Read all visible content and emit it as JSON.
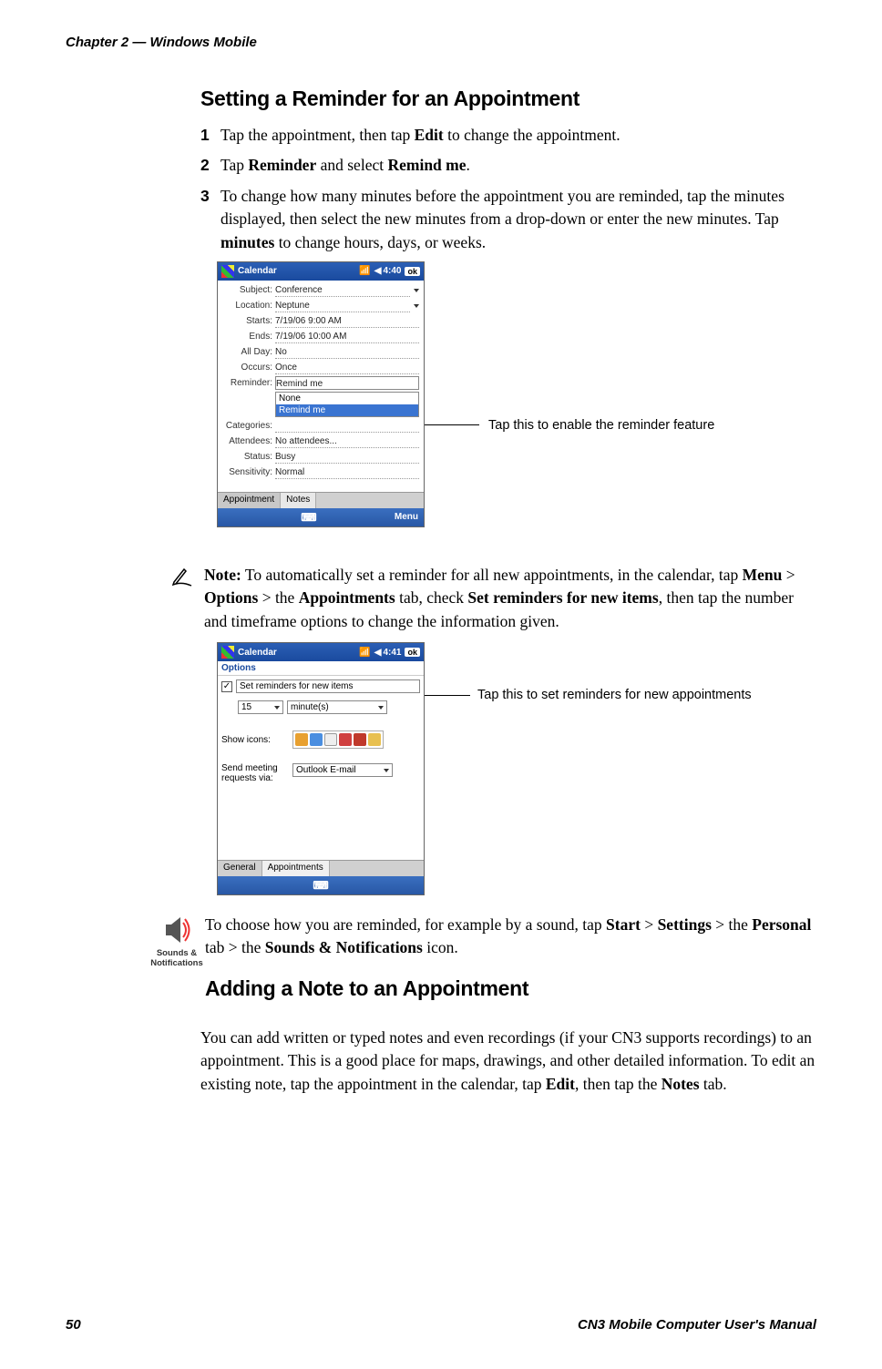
{
  "header": {
    "chapter": "Chapter 2 — Windows Mobile"
  },
  "footer": {
    "page": "50",
    "manual": "CN3 Mobile Computer User's Manual"
  },
  "section1": {
    "title": "Setting a Reminder for an Appointment",
    "steps": {
      "s1": {
        "num": "1",
        "pre": "Tap the appointment, then tap ",
        "bold": "Edit",
        "post": " to change the appointment."
      },
      "s2": {
        "num": "2",
        "pre": "Tap ",
        "bold1": "Reminder",
        "mid": " and select ",
        "bold2": "Remind me",
        "post": "."
      },
      "s3": {
        "num": "3",
        "pre": "To change how many minutes before the appointment you are reminded, tap the minutes displayed, then select the new minutes from a drop-down or enter the new minutes. Tap ",
        "bold": "minutes",
        "post": " to change hours, days, or weeks."
      }
    }
  },
  "shot1": {
    "title": "Calendar",
    "time": "4:40",
    "ok": "ok",
    "rows": {
      "subject": {
        "label": "Subject:",
        "value": "Conference"
      },
      "location": {
        "label": "Location:",
        "value": "Neptune"
      },
      "starts": {
        "label": "Starts:",
        "value": "7/19/06    9:00 AM"
      },
      "ends": {
        "label": "Ends:",
        "value": "7/19/06    10:00 AM"
      },
      "allday": {
        "label": "All Day:",
        "value": "No"
      },
      "occurs": {
        "label": "Occurs:",
        "value": "Once"
      },
      "reminder": {
        "label": "Reminder:",
        "value": "Remind me"
      },
      "categories": {
        "label": "Categories:",
        "value": ""
      },
      "attendees": {
        "label": "Attendees:",
        "value": "No attendees..."
      },
      "status": {
        "label": "Status:",
        "value": "Busy"
      },
      "sensitivity": {
        "label": "Sensitivity:",
        "value": "Normal"
      }
    },
    "dropdown": {
      "opt1": "None",
      "opt2": "Remind me"
    },
    "tabs": {
      "t1": "Appointment",
      "t2": "Notes"
    },
    "menu": "Menu",
    "callout": "Tap this to enable the reminder feature"
  },
  "note": {
    "pre": "Note:",
    "t1": " To automatically set a reminder for all new appointments, in the calendar, tap ",
    "b1": "Menu",
    "gt1": " > ",
    "b2": "Options",
    "gt2": " > the ",
    "b3": "Appointments",
    "t2": " tab, check ",
    "b4": "Set reminders for new items",
    "t3": ", then tap the number and timeframe options to change the information given."
  },
  "shot2": {
    "title": "Calendar",
    "time": "4:41",
    "ok": "ok",
    "options": "Options",
    "checkrow": "Set reminders for new items",
    "num": "15",
    "unit": "minute(s)",
    "showicons": "Show icons:",
    "sendmeeting": "Send meeting requests via:",
    "outlook": "Outlook E-mail",
    "tabs": {
      "t1": "General",
      "t2": "Appointments"
    },
    "callout": "Tap this to set reminders for new appointments"
  },
  "sounds": {
    "iconlabel": "Sounds & Notifications",
    "t1": "To choose how you are reminded, for example by a sound, tap ",
    "b1": "Start",
    "gt1": " > ",
    "b2": "Settings",
    "gt2": " > the ",
    "b3": "Personal",
    "t2": " tab > the ",
    "b4": "Sounds & Notifications",
    "t3": " icon."
  },
  "section2": {
    "title": "Adding a Note to an Appointment",
    "p1_pre": "You can add written or typed notes and even recordings (if your CN3 supports recordings) to an appointment. This is a good place for maps, drawings, and other detailed information. To edit an existing note, tap the appointment in the calendar, tap ",
    "p1_b1": "Edit",
    "p1_mid": ", then tap the ",
    "p1_b2": "Notes",
    "p1_post": " tab."
  }
}
